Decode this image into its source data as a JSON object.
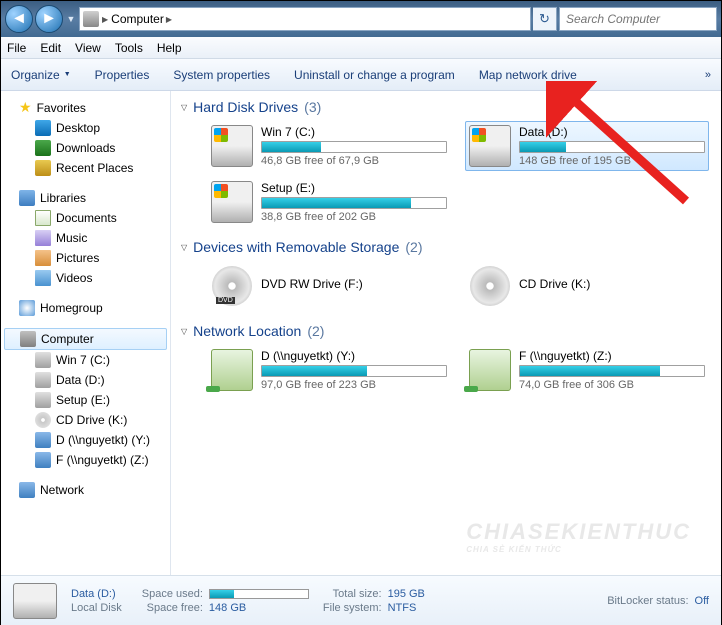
{
  "titlebar": {
    "breadcrumb_root": "Computer",
    "search_placeholder": "Search Computer"
  },
  "menubar": [
    "File",
    "Edit",
    "View",
    "Tools",
    "Help"
  ],
  "toolbar": {
    "organize": "Organize",
    "items": [
      "Properties",
      "System properties",
      "Uninstall or change a program",
      "Map network drive"
    ]
  },
  "sidebar": {
    "favorites": {
      "label": "Favorites",
      "items": [
        "Desktop",
        "Downloads",
        "Recent Places"
      ]
    },
    "libraries": {
      "label": "Libraries",
      "items": [
        "Documents",
        "Music",
        "Pictures",
        "Videos"
      ]
    },
    "homegroup": {
      "label": "Homegroup"
    },
    "computer": {
      "label": "Computer",
      "items": [
        "Win 7 (C:)",
        "Data (D:)",
        "Setup (E:)",
        "CD Drive (K:)",
        "D (\\\\nguyetkt) (Y:)",
        "F (\\\\nguyetkt) (Z:)"
      ]
    },
    "network": {
      "label": "Network"
    }
  },
  "sections": {
    "hdd": {
      "title": "Hard Disk Drives",
      "count": "(3)",
      "drives": [
        {
          "name": "Win 7 (C:)",
          "stat": "46,8 GB free of 67,9 GB",
          "fill": 32
        },
        {
          "name": "Data (D:)",
          "stat": "148 GB free of 195 GB",
          "fill": 25,
          "selected": true
        },
        {
          "name": "Setup (E:)",
          "stat": "38,8 GB free of 202 GB",
          "fill": 81
        }
      ]
    },
    "removable": {
      "title": "Devices with Removable Storage",
      "count": "(2)",
      "drives": [
        {
          "name": "DVD RW Drive (F:)",
          "kind": "dvd"
        },
        {
          "name": "CD Drive (K:)",
          "kind": "cd"
        }
      ]
    },
    "network": {
      "title": "Network Location",
      "count": "(2)",
      "drives": [
        {
          "name": "D (\\\\nguyetkt) (Y:)",
          "stat": "97,0 GB free of 223 GB",
          "fill": 57
        },
        {
          "name": "F (\\\\nguyetkt) (Z:)",
          "stat": "74,0 GB free of 306 GB",
          "fill": 76
        }
      ]
    }
  },
  "statusbar": {
    "name": "Data (D:)",
    "type": "Local Disk",
    "rows": [
      [
        "Space used:",
        ""
      ],
      [
        "Space free:",
        "148 GB"
      ],
      [
        "Total size:",
        "195 GB"
      ],
      [
        "File system:",
        "NTFS"
      ],
      [
        "BitLocker status:",
        "Off"
      ]
    ]
  },
  "watermark": {
    "main": "CHIASEKIENTHUC",
    "sub": "CHIA SẺ KIẾN THỨC"
  }
}
